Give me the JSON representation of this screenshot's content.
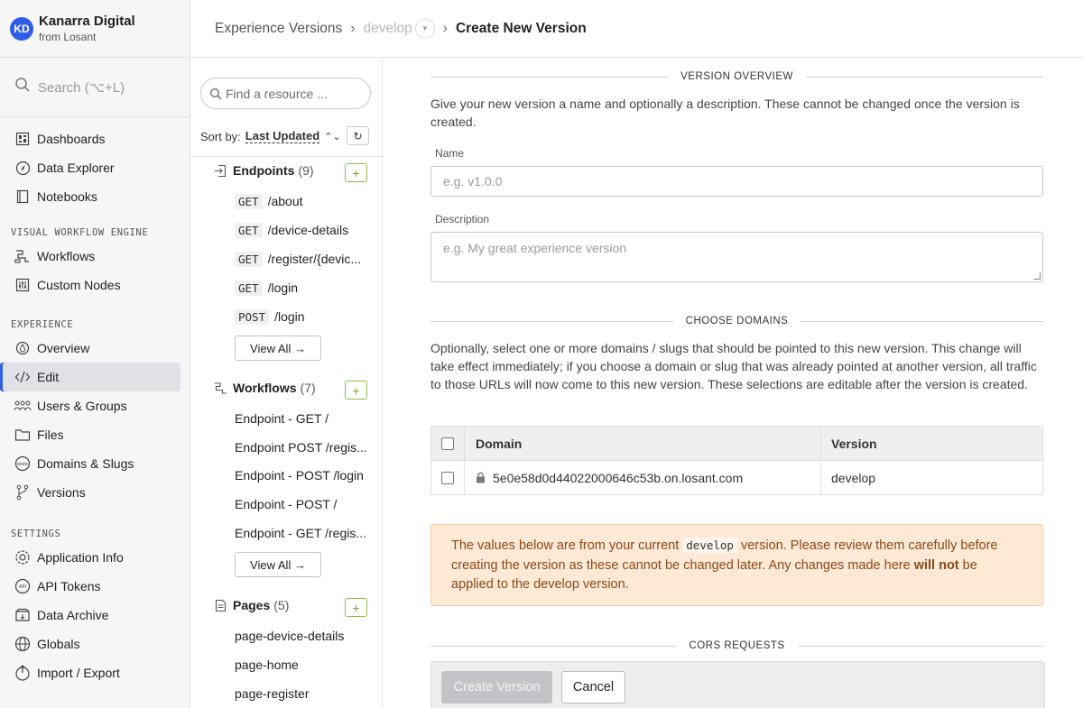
{
  "org": {
    "initials": "KD",
    "name": "Kanarra Digital",
    "sub": "from Losant"
  },
  "search": {
    "placeholder": "Search (⌥+L)"
  },
  "nav": {
    "top_items": [
      {
        "label": "Dashboards",
        "icon": "dashboard-icon"
      },
      {
        "label": "Data Explorer",
        "icon": "compass-icon"
      },
      {
        "label": "Notebooks",
        "icon": "notebook-icon"
      }
    ],
    "vwe_heading": "VISUAL WORKFLOW ENGINE",
    "vwe_items": [
      {
        "label": "Workflows",
        "icon": "workflow-icon"
      },
      {
        "label": "Custom Nodes",
        "icon": "sliders-icon"
      }
    ],
    "exp_heading": "EXPERIENCE",
    "exp_items": [
      {
        "label": "Overview",
        "icon": "drop-icon"
      },
      {
        "label": "Edit",
        "icon": "code-edit-icon"
      },
      {
        "label": "Users & Groups",
        "icon": "users-icon"
      },
      {
        "label": "Files",
        "icon": "folder-icon"
      },
      {
        "label": "Domains & Slugs",
        "icon": "globe-www-icon"
      },
      {
        "label": "Versions",
        "icon": "branch-icon"
      }
    ],
    "settings_heading": "SETTINGS",
    "settings_items": [
      {
        "label": "Application Info",
        "icon": "gear-icon"
      },
      {
        "label": "API Tokens",
        "icon": "api-token-icon"
      },
      {
        "label": "Data Archive",
        "icon": "archive-icon"
      },
      {
        "label": "Globals",
        "icon": "globe-icon"
      },
      {
        "label": "Import / Export",
        "icon": "import-export-icon"
      }
    ]
  },
  "resources": {
    "search_placeholder": "Find a resource ...",
    "sort_label": "Sort by:",
    "sort_value": "Last Updated",
    "endpoints": {
      "title": "Endpoints",
      "count": "(9)",
      "items": [
        {
          "method": "GET",
          "path": "/about"
        },
        {
          "method": "GET",
          "path": "/device-details"
        },
        {
          "method": "GET",
          "path": "/register/{devic..."
        },
        {
          "method": "GET",
          "path": "/login"
        },
        {
          "method": "POST",
          "path": "/login"
        }
      ]
    },
    "workflows": {
      "title": "Workflows",
      "count": "(7)",
      "items": [
        "Endpoint - GET /",
        "Endpoint POST /regis...",
        "Endpoint - POST /login",
        "Endpoint - POST /",
        "Endpoint - GET /regis..."
      ]
    },
    "pages": {
      "title": "Pages",
      "count": "(5)",
      "items": [
        "page-device-details",
        "page-home",
        "page-register"
      ]
    },
    "view_all": "View All →"
  },
  "breadcrumb": {
    "root": "Experience Versions",
    "version": "develop",
    "current": "Create New Version"
  },
  "form": {
    "overview_heading": "VERSION OVERVIEW",
    "overview_text": "Give your new version a name and optionally a description. These cannot be changed once the version is created.",
    "name_label": "Name",
    "name_placeholder": "e.g. v1.0.0",
    "desc_label": "Description",
    "desc_placeholder": "e.g. My great experience version",
    "domains_heading": "CHOOSE DOMAINS",
    "domains_text": "Optionally, select one or more domains / slugs that should be pointed to this new version. This change will take effect immediately; if you choose a domain or slug that was already pointed at another version, all traffic to those URLs will now come to this new version. These selections are editable after the version is created.",
    "table": {
      "col_domain": "Domain",
      "col_version": "Version",
      "rows": [
        {
          "domain": "5e0e58d0d44022000646c53b.on.losant.com",
          "version": "develop"
        }
      ]
    },
    "warning": {
      "part1": "The values below are from your current ",
      "code": "develop",
      "part2": " version. Please review them carefully before creating the version as these cannot be changed later. Any changes made here ",
      "bold": "will not",
      "part3": " be applied to the develop version."
    },
    "cors_heading": "CORS REQUESTS",
    "create_label": "Create Version",
    "cancel_label": "Cancel"
  },
  "colors": {
    "accent": "#2f5de8",
    "add_green": "#6ea830",
    "warning_bg": "#fde9d6"
  }
}
